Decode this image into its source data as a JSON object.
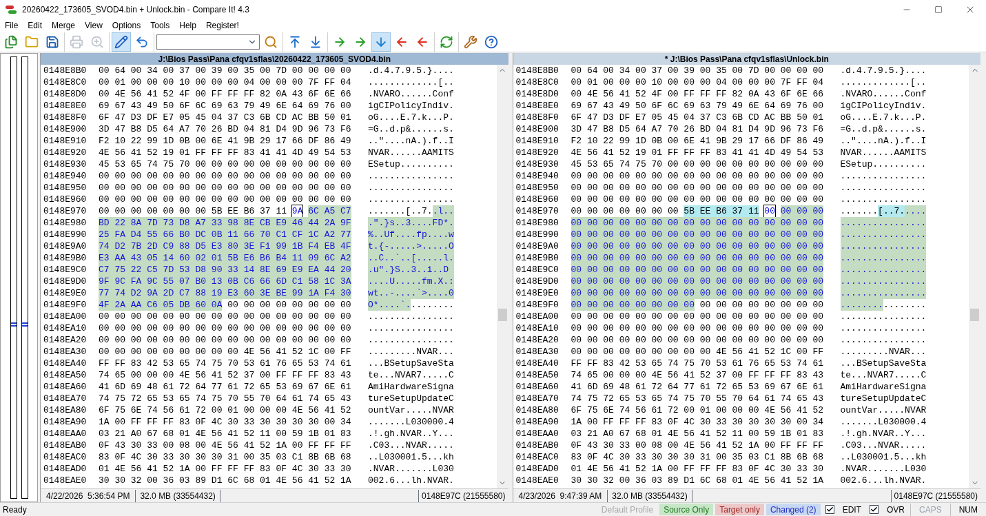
{
  "window": {
    "title": "20260422_173605_SVOD4.bin + Unlock.bin - Compare It! 4.3"
  },
  "menu": [
    "File",
    "Edit",
    "Merge",
    "View",
    "Options",
    "Tools",
    "Help",
    "Register!"
  ],
  "toolbar": [
    [
      {
        "kind": "button",
        "pressed": false,
        "disabled": false
      },
      {
        "kind": "button",
        "pressed": false,
        "disabled": false
      },
      {
        "kind": "button",
        "pressed": false,
        "disabled": false
      }
    ],
    [
      {
        "kind": "button",
        "pressed": false,
        "disabled": true
      },
      {
        "kind": "button",
        "pressed": false,
        "disabled": true
      }
    ],
    [
      {
        "kind": "button",
        "pressed": true,
        "disabled": false
      },
      {
        "kind": "button",
        "pressed": false,
        "disabled": false
      }
    ],
    [
      {
        "kind": "combo"
      },
      {
        "kind": "button",
        "pressed": false,
        "disabled": false
      }
    ],
    [
      {
        "kind": "button",
        "pressed": false,
        "disabled": false
      },
      {
        "kind": "button",
        "pressed": false,
        "disabled": false
      }
    ],
    [
      {
        "kind": "button",
        "pressed": false,
        "disabled": false
      },
      {
        "kind": "button",
        "pressed": false,
        "disabled": false
      },
      {
        "kind": "button",
        "pressed": true,
        "disabled": false
      },
      {
        "kind": "button",
        "pressed": false,
        "disabled": false
      },
      {
        "kind": "button",
        "pressed": false,
        "disabled": false
      }
    ],
    [
      {
        "kind": "button",
        "pressed": false,
        "disabled": false
      }
    ],
    [
      {
        "kind": "button",
        "pressed": false,
        "disabled": false
      },
      {
        "kind": "button",
        "pressed": false,
        "disabled": false
      }
    ]
  ],
  "panes": [
    {
      "title": "J:\\Bios Pass\\Pana cfqv1sflas\\20260422_173605_SVOD4.bin",
      "active": true,
      "rows": [
        {
          "offset": "0148E8B0",
          "hex": [
            {
              "kind": "same",
              "text": "00 64 00 34 00 37 00 39 00 35 00 7D 00 00 00 00"
            }
          ],
          "ascii": [
            {
              "kind": "same",
              "text": ".d.4.7.9.5.}...."
            }
          ]
        },
        {
          "offset": "0148E8C0",
          "hex": [
            {
              "kind": "same",
              "text": "00 01 00 00 00 10 00 00 00 04 00 00 00 7F FF 04"
            }
          ],
          "ascii": [
            {
              "kind": "same",
              "text": ".............[.."
            }
          ]
        },
        {
          "offset": "0148E8D0",
          "hex": [
            {
              "kind": "same",
              "text": "00 4E 56 41 52 4F 00 FF FF FF 82 0A 43 6F 6E 66"
            }
          ],
          "ascii": [
            {
              "kind": "same",
              "text": ".NVARO......Conf"
            }
          ]
        },
        {
          "offset": "0148E8E0",
          "hex": [
            {
              "kind": "same",
              "text": "69 67 43 49 50 6F 6C 69 63 79 49 6E 64 69 76 00"
            }
          ],
          "ascii": [
            {
              "kind": "same",
              "text": "igCIPolicyIndiv."
            }
          ]
        },
        {
          "offset": "0148E8F0",
          "hex": [
            {
              "kind": "same",
              "text": "6F 47 D3 DF E7 05 45 04 37 C3 6B CD AC BB 50 01"
            }
          ],
          "ascii": [
            {
              "kind": "same",
              "text": "oG....E.7.k...P."
            }
          ]
        },
        {
          "offset": "0148E900",
          "hex": [
            {
              "kind": "same",
              "text": "3D 47 B8 D5 64 A7 70 26 BD 04 81 D4 9D 96 73 F6"
            }
          ],
          "ascii": [
            {
              "kind": "same",
              "text": "=G..d.p&......s."
            }
          ]
        },
        {
          "offset": "0148E910",
          "hex": [
            {
              "kind": "same",
              "text": "F2 10 22 99 1D 0B 00 6E 41 9B 29 17 66 DF 86 49"
            }
          ],
          "ascii": [
            {
              "kind": "same",
              "text": "..\"....nA.).f..I"
            }
          ]
        },
        {
          "offset": "0148E920",
          "hex": [
            {
              "kind": "same",
              "text": "4E 56 41 52 19 01 FF FF FF 83 41 41 4D 49 54 53"
            }
          ],
          "ascii": [
            {
              "kind": "same",
              "text": "NVAR......AAMITS"
            }
          ]
        },
        {
          "offset": "0148E930",
          "hex": [
            {
              "kind": "same",
              "text": "45 53 65 74 75 70 00 00 00 00 00 00 00 00 00 00"
            }
          ],
          "ascii": [
            {
              "kind": "same",
              "text": "ESetup.........."
            }
          ]
        },
        {
          "offset": "0148E940",
          "hex": [
            {
              "kind": "same",
              "text": "00 00 00 00 00 00 00 00 00 00 00 00 00 00 00 00"
            }
          ],
          "ascii": [
            {
              "kind": "same",
              "text": "................"
            }
          ]
        },
        {
          "offset": "0148E950",
          "hex": [
            {
              "kind": "same",
              "text": "00 00 00 00 00 00 00 00 00 00 00 00 00 00 00 00"
            }
          ],
          "ascii": [
            {
              "kind": "same",
              "text": "................"
            }
          ]
        },
        {
          "offset": "0148E960",
          "hex": [
            {
              "kind": "same",
              "text": "00 00 00 00 00 00 00 00 00 00 00 00 00 00 00 00"
            }
          ],
          "ascii": [
            {
              "kind": "same",
              "text": "................"
            }
          ]
        },
        {
          "offset": "0148E970",
          "hex": [
            {
              "kind": "same",
              "text": "00 00 00 00 00 00 00 5B EE B6 37 11"
            },
            {
              "kind": "cursor",
              "text": "9A"
            },
            {
              "kind": "changed",
              "text": "6C A5 C7"
            }
          ],
          "ascii": [
            {
              "kind": "same",
              "text": ".......[..7."
            },
            {
              "kind": "changed",
              "text": ".l.."
            }
          ]
        },
        {
          "offset": "0148E980",
          "hex": [
            {
              "kind": "changed",
              "text": "BD 22 8A 7D 73 D8 A7 33 98 8E CB E9 46 44 2A 9F"
            }
          ],
          "ascii": [
            {
              "kind": "changed",
              "text": ".\".}s..3....FD*."
            }
          ]
        },
        {
          "offset": "0148E990",
          "hex": [
            {
              "kind": "changed",
              "text": "25 FA D4 55 66 B0 DC 0B 11 66 70 C1 CF 1C A2 77"
            }
          ],
          "ascii": [
            {
              "kind": "changed",
              "text": "%..Uf....fp....w"
            }
          ]
        },
        {
          "offset": "0148E9A0",
          "hex": [
            {
              "kind": "changed",
              "text": "74 D2 7B 2D C9 88 D5 E3 80 3E F1 99 1B F4 EB 4F"
            }
          ],
          "ascii": [
            {
              "kind": "changed",
              "text": "t.{-.....>.....O"
            }
          ]
        },
        {
          "offset": "0148E9B0",
          "hex": [
            {
              "kind": "changed",
              "text": "E3 AA 43 05 14 60 02 01 5B E6 B6 B4 11 09 6C A2"
            }
          ],
          "ascii": [
            {
              "kind": "changed",
              "text": "..C..`..[.....l."
            }
          ]
        },
        {
          "offset": "0148E9C0",
          "hex": [
            {
              "kind": "changed",
              "text": "C7 75 22 C5 7D 53 D8 90 33 14 8E 69 E9 EA 44 20"
            }
          ],
          "ascii": [
            {
              "kind": "changed",
              "text": ".u\".}S..3..i..D "
            }
          ]
        },
        {
          "offset": "0148E9D0",
          "hex": [
            {
              "kind": "changed",
              "text": "9F 9C FA 9C 55 07 B0 13 0B C6 66 6D C1 58 1C 3A"
            }
          ],
          "ascii": [
            {
              "kind": "changed",
              "text": "....U.....fm.X.:"
            }
          ]
        },
        {
          "offset": "0148E9E0",
          "hex": [
            {
              "kind": "changed",
              "text": "77 74 D2 9A 2D C7 88 19 E3 60 3E BE 99 1A F4 30"
            }
          ],
          "ascii": [
            {
              "kind": "changed",
              "text": "wt..-....`>....0"
            }
          ]
        },
        {
          "offset": "0148E9F0",
          "hex": [
            {
              "kind": "changed",
              "text": "4F 2A AA C6 05 DB 60 0A"
            },
            {
              "kind": "same",
              "text": "00 00 00 00 00 00 00 00"
            }
          ],
          "ascii": [
            {
              "kind": "changed",
              "text": "O*....`."
            },
            {
              "kind": "same",
              "text": "........"
            }
          ]
        },
        {
          "offset": "0148EA00",
          "hex": [
            {
              "kind": "same",
              "text": "00 00 00 00 00 00 00 00 00 00 00 00 00 00 00 00"
            }
          ],
          "ascii": [
            {
              "kind": "same",
              "text": "................"
            }
          ]
        },
        {
          "offset": "0148EA10",
          "hex": [
            {
              "kind": "same",
              "text": "00 00 00 00 00 00 00 00 00 00 00 00 00 00 00 00"
            }
          ],
          "ascii": [
            {
              "kind": "same",
              "text": "................"
            }
          ]
        },
        {
          "offset": "0148EA20",
          "hex": [
            {
              "kind": "same",
              "text": "00 00 00 00 00 00 00 00 00 00 00 00 00 00 00 00"
            }
          ],
          "ascii": [
            {
              "kind": "same",
              "text": "................"
            }
          ]
        },
        {
          "offset": "0148EA30",
          "hex": [
            {
              "kind": "same",
              "text": "00 00 00 00 00 00 00 00 00 4E 56 41 52 1C 00 FF"
            }
          ],
          "ascii": [
            {
              "kind": "same",
              "text": ".........NVAR..."
            }
          ]
        },
        {
          "offset": "0148EA40",
          "hex": [
            {
              "kind": "same",
              "text": "FF FF 83 42 53 65 74 75 70 53 61 76 65 53 74 61"
            }
          ],
          "ascii": [
            {
              "kind": "same",
              "text": "...BSetupSaveSta"
            }
          ]
        },
        {
          "offset": "0148EA50",
          "hex": [
            {
              "kind": "same",
              "text": "74 65 00 00 00 4E 56 41 52 37 00 FF FF FF 83 43"
            }
          ],
          "ascii": [
            {
              "kind": "same",
              "text": "te...NVAR7.....C"
            }
          ]
        },
        {
          "offset": "0148EA60",
          "hex": [
            {
              "kind": "same",
              "text": "41 6D 69 48 61 72 64 77 61 72 65 53 69 67 6E 61"
            }
          ],
          "ascii": [
            {
              "kind": "same",
              "text": "AmiHardwareSigna"
            }
          ]
        },
        {
          "offset": "0148EA70",
          "hex": [
            {
              "kind": "same",
              "text": "74 75 72 65 53 65 74 75 70 55 70 64 61 74 65 43"
            }
          ],
          "ascii": [
            {
              "kind": "same",
              "text": "tureSetupUpdateC"
            }
          ]
        },
        {
          "offset": "0148EA80",
          "hex": [
            {
              "kind": "same",
              "text": "6F 75 6E 74 56 61 72 00 01 00 00 00 4E 56 41 52"
            }
          ],
          "ascii": [
            {
              "kind": "same",
              "text": "ountVar.....NVAR"
            }
          ]
        },
        {
          "offset": "0148EA90",
          "hex": [
            {
              "kind": "same",
              "text": "1A 00 FF FF FF 83 0F 4C 30 33 30 30 30 30 00 34"
            }
          ],
          "ascii": [
            {
              "kind": "same",
              "text": ".......L030000.4"
            }
          ]
        },
        {
          "offset": "0148EAA0",
          "hex": [
            {
              "kind": "same",
              "text": "03 21 A0 67 68 01 4E 56 41 52 11 00 59 1B 01 83"
            }
          ],
          "ascii": [
            {
              "kind": "same",
              "text": ".!.gh.NVAR..Y..."
            }
          ]
        },
        {
          "offset": "0148EAB0",
          "hex": [
            {
              "kind": "same",
              "text": "0F 43 30 33 00 08 00 4E 56 41 52 1A 00 FF FF FF"
            }
          ],
          "ascii": [
            {
              "kind": "same",
              "text": ".C03...NVAR....."
            }
          ]
        },
        {
          "offset": "0148EAC0",
          "hex": [
            {
              "kind": "same",
              "text": "83 0F 4C 30 33 30 30 30 31 00 35 03 C1 8B 6B 68"
            }
          ],
          "ascii": [
            {
              "kind": "same",
              "text": "..L030001.5...kh"
            }
          ]
        },
        {
          "offset": "0148EAD0",
          "hex": [
            {
              "kind": "same",
              "text": "01 4E 56 41 52 1A 00 FF FF FF 83 0F 4C 30 33 30"
            }
          ],
          "ascii": [
            {
              "kind": "same",
              "text": ".NVAR.......L030"
            }
          ]
        },
        {
          "offset": "0148EAE0",
          "hex": [
            {
              "kind": "same",
              "text": "30 30 32 00 36 03 89 D1 6C 68 01 4E 56 41 52 1A"
            }
          ],
          "ascii": [
            {
              "kind": "same",
              "text": "002.6...lh.NVAR."
            }
          ]
        }
      ],
      "status": {
        "date": "4/22/2026  5:36:54 PM",
        "size": "32.0 MB (33554432)",
        "position": "0148E97C (21555580)"
      }
    },
    {
      "title": "* J:\\Bios Pass\\Pana cfqv1sflas\\Unlock.bin",
      "active": false,
      "rows": [
        {
          "offset": "0148E8B0",
          "hex": [
            {
              "kind": "same",
              "text": "00 64 00 34 00 37 00 39 00 35 00 7D 00 00 00 00"
            }
          ],
          "ascii": [
            {
              "kind": "same",
              "text": ".d.4.7.9.5.}...."
            }
          ]
        },
        {
          "offset": "0148E8C0",
          "hex": [
            {
              "kind": "same",
              "text": "00 01 00 00 00 10 00 00 00 04 00 00 00 7F FF 04"
            }
          ],
          "ascii": [
            {
              "kind": "same",
              "text": ".............[.."
            }
          ]
        },
        {
          "offset": "0148E8D0",
          "hex": [
            {
              "kind": "same",
              "text": "00 4E 56 41 52 4F 00 FF FF FF 82 0A 43 6F 6E 66"
            }
          ],
          "ascii": [
            {
              "kind": "same",
              "text": ".NVARO......Conf"
            }
          ]
        },
        {
          "offset": "0148E8E0",
          "hex": [
            {
              "kind": "same",
              "text": "69 67 43 49 50 6F 6C 69 63 79 49 6E 64 69 76 00"
            }
          ],
          "ascii": [
            {
              "kind": "same",
              "text": "igCIPolicyIndiv."
            }
          ]
        },
        {
          "offset": "0148E8F0",
          "hex": [
            {
              "kind": "same",
              "text": "6F 47 D3 DF E7 05 45 04 37 C3 6B CD AC BB 50 01"
            }
          ],
          "ascii": [
            {
              "kind": "same",
              "text": "oG....E.7.k...P."
            }
          ]
        },
        {
          "offset": "0148E900",
          "hex": [
            {
              "kind": "same",
              "text": "3D 47 B8 D5 64 A7 70 26 BD 04 81 D4 9D 96 73 F6"
            }
          ],
          "ascii": [
            {
              "kind": "same",
              "text": "=G..d.p&......s."
            }
          ]
        },
        {
          "offset": "0148E910",
          "hex": [
            {
              "kind": "same",
              "text": "F2 10 22 99 1D 0B 00 6E 41 9B 29 17 66 DF 86 49"
            }
          ],
          "ascii": [
            {
              "kind": "same",
              "text": "..\"....nA.).f..I"
            }
          ]
        },
        {
          "offset": "0148E920",
          "hex": [
            {
              "kind": "same",
              "text": "4E 56 41 52 19 01 FF FF FF 83 41 41 4D 49 54 53"
            }
          ],
          "ascii": [
            {
              "kind": "same",
              "text": "NVAR......AAMITS"
            }
          ]
        },
        {
          "offset": "0148E930",
          "hex": [
            {
              "kind": "same",
              "text": "45 53 65 74 75 70 00 00 00 00 00 00 00 00 00 00"
            }
          ],
          "ascii": [
            {
              "kind": "same",
              "text": "ESetup.........."
            }
          ]
        },
        {
          "offset": "0148E940",
          "hex": [
            {
              "kind": "same",
              "text": "00 00 00 00 00 00 00 00 00 00 00 00 00 00 00 00"
            }
          ],
          "ascii": [
            {
              "kind": "same",
              "text": "................"
            }
          ]
        },
        {
          "offset": "0148E950",
          "hex": [
            {
              "kind": "same",
              "text": "00 00 00 00 00 00 00 00 00 00 00 00 00 00 00 00"
            }
          ],
          "ascii": [
            {
              "kind": "same",
              "text": "................"
            }
          ]
        },
        {
          "offset": "0148E960",
          "hex": [
            {
              "kind": "same",
              "text": "00 00 00 00 00 00 00 00 00 00 00 00 00 00 00 00"
            }
          ],
          "ascii": [
            {
              "kind": "same",
              "text": "................"
            }
          ]
        },
        {
          "offset": "0148E970",
          "hex": [
            {
              "kind": "same",
              "text": "00 00 00 00 00 00 00"
            },
            {
              "kind": "matched",
              "text": "5B EE B6 37 11"
            },
            {
              "kind": "cursor",
              "text": "00"
            },
            {
              "kind": "changed",
              "text": "00 00 00"
            }
          ],
          "ascii": [
            {
              "kind": "same",
              "text": "......."
            },
            {
              "kind": "matched",
              "text": "[..7."
            },
            {
              "kind": "changed",
              "text": "...."
            }
          ]
        },
        {
          "offset": "0148E980",
          "hex": [
            {
              "kind": "changed",
              "text": "00 00 00 00 00 00 00 00 00 00 00 00 00 00 00 00"
            }
          ],
          "ascii": [
            {
              "kind": "changed",
              "text": "................"
            }
          ]
        },
        {
          "offset": "0148E990",
          "hex": [
            {
              "kind": "changed",
              "text": "00 00 00 00 00 00 00 00 00 00 00 00 00 00 00 00"
            }
          ],
          "ascii": [
            {
              "kind": "changed",
              "text": "................"
            }
          ]
        },
        {
          "offset": "0148E9A0",
          "hex": [
            {
              "kind": "changed",
              "text": "00 00 00 00 00 00 00 00 00 00 00 00 00 00 00 00"
            }
          ],
          "ascii": [
            {
              "kind": "changed",
              "text": "................"
            }
          ]
        },
        {
          "offset": "0148E9B0",
          "hex": [
            {
              "kind": "changed",
              "text": "00 00 00 00 00 00 00 00 00 00 00 00 00 00 00 00"
            }
          ],
          "ascii": [
            {
              "kind": "changed",
              "text": "................"
            }
          ]
        },
        {
          "offset": "0148E9C0",
          "hex": [
            {
              "kind": "changed",
              "text": "00 00 00 00 00 00 00 00 00 00 00 00 00 00 00 00"
            }
          ],
          "ascii": [
            {
              "kind": "changed",
              "text": "................"
            }
          ]
        },
        {
          "offset": "0148E9D0",
          "hex": [
            {
              "kind": "changed",
              "text": "00 00 00 00 00 00 00 00 00 00 00 00 00 00 00 00"
            }
          ],
          "ascii": [
            {
              "kind": "changed",
              "text": "................"
            }
          ]
        },
        {
          "offset": "0148E9E0",
          "hex": [
            {
              "kind": "changed",
              "text": "00 00 00 00 00 00 00 00 00 00 00 00 00 00 00 00"
            }
          ],
          "ascii": [
            {
              "kind": "changed",
              "text": "................"
            }
          ]
        },
        {
          "offset": "0148E9F0",
          "hex": [
            {
              "kind": "changed",
              "text": "00 00 00 00 00 00 00 00"
            },
            {
              "kind": "same",
              "text": "00 00 00 00 00 00 00 00"
            }
          ],
          "ascii": [
            {
              "kind": "changed",
              "text": "........"
            },
            {
              "kind": "same",
              "text": "........"
            }
          ]
        },
        {
          "offset": "0148EA00",
          "hex": [
            {
              "kind": "same",
              "text": "00 00 00 00 00 00 00 00 00 00 00 00 00 00 00 00"
            }
          ],
          "ascii": [
            {
              "kind": "same",
              "text": "................"
            }
          ]
        },
        {
          "offset": "0148EA10",
          "hex": [
            {
              "kind": "same",
              "text": "00 00 00 00 00 00 00 00 00 00 00 00 00 00 00 00"
            }
          ],
          "ascii": [
            {
              "kind": "same",
              "text": "................"
            }
          ]
        },
        {
          "offset": "0148EA20",
          "hex": [
            {
              "kind": "same",
              "text": "00 00 00 00 00 00 00 00 00 00 00 00 00 00 00 00"
            }
          ],
          "ascii": [
            {
              "kind": "same",
              "text": "................"
            }
          ]
        },
        {
          "offset": "0148EA30",
          "hex": [
            {
              "kind": "same",
              "text": "00 00 00 00 00 00 00 00 00 4E 56 41 52 1C 00 FF"
            }
          ],
          "ascii": [
            {
              "kind": "same",
              "text": ".........NVAR..."
            }
          ]
        },
        {
          "offset": "0148EA40",
          "hex": [
            {
              "kind": "same",
              "text": "FF FF 83 42 53 65 74 75 70 53 61 76 65 53 74 61"
            }
          ],
          "ascii": [
            {
              "kind": "same",
              "text": "...BSetupSaveSta"
            }
          ]
        },
        {
          "offset": "0148EA50",
          "hex": [
            {
              "kind": "same",
              "text": "74 65 00 00 00 4E 56 41 52 37 00 FF FF FF 83 43"
            }
          ],
          "ascii": [
            {
              "kind": "same",
              "text": "te...NVAR7.....C"
            }
          ]
        },
        {
          "offset": "0148EA60",
          "hex": [
            {
              "kind": "same",
              "text": "41 6D 69 48 61 72 64 77 61 72 65 53 69 67 6E 61"
            }
          ],
          "ascii": [
            {
              "kind": "same",
              "text": "AmiHardwareSigna"
            }
          ]
        },
        {
          "offset": "0148EA70",
          "hex": [
            {
              "kind": "same",
              "text": "74 75 72 65 53 65 74 75 70 55 70 64 61 74 65 43"
            }
          ],
          "ascii": [
            {
              "kind": "same",
              "text": "tureSetupUpdateC"
            }
          ]
        },
        {
          "offset": "0148EA80",
          "hex": [
            {
              "kind": "same",
              "text": "6F 75 6E 74 56 61 72 00 01 00 00 00 4E 56 41 52"
            }
          ],
          "ascii": [
            {
              "kind": "same",
              "text": "ountVar.....NVAR"
            }
          ]
        },
        {
          "offset": "0148EA90",
          "hex": [
            {
              "kind": "same",
              "text": "1A 00 FF FF FF 83 0F 4C 30 33 30 30 30 30 00 34"
            }
          ],
          "ascii": [
            {
              "kind": "same",
              "text": ".......L030000.4"
            }
          ]
        },
        {
          "offset": "0148EAA0",
          "hex": [
            {
              "kind": "same",
              "text": "03 21 A0 67 68 01 4E 56 41 52 11 00 59 1B 01 83"
            }
          ],
          "ascii": [
            {
              "kind": "same",
              "text": ".!.gh.NVAR..Y..."
            }
          ]
        },
        {
          "offset": "0148EAB0",
          "hex": [
            {
              "kind": "same",
              "text": "0F 43 30 33 00 08 00 4E 56 41 52 1A 00 FF FF FF"
            }
          ],
          "ascii": [
            {
              "kind": "same",
              "text": ".C03...NVAR....."
            }
          ]
        },
        {
          "offset": "0148EAC0",
          "hex": [
            {
              "kind": "same",
              "text": "83 0F 4C 30 33 30 30 30 31 00 35 03 C1 8B 6B 68"
            }
          ],
          "ascii": [
            {
              "kind": "same",
              "text": "..L030001.5...kh"
            }
          ]
        },
        {
          "offset": "0148EAD0",
          "hex": [
            {
              "kind": "same",
              "text": "01 4E 56 41 52 1A 00 FF FF FF 83 0F 4C 30 33 30"
            }
          ],
          "ascii": [
            {
              "kind": "same",
              "text": ".NVAR.......L030"
            }
          ]
        },
        {
          "offset": "0148EAE0",
          "hex": [
            {
              "kind": "same",
              "text": "30 30 32 00 36 03 89 D1 6C 68 01 4E 56 41 52 1A"
            }
          ],
          "ascii": [
            {
              "kind": "same",
              "text": "002.6...lh.NVAR."
            }
          ]
        }
      ],
      "status": {
        "date": "4/23/2026  9:47:39 AM",
        "size": "32.0 MB (33554432)",
        "position": "0148E97C (21555580)"
      }
    }
  ],
  "status_bar": {
    "message": "Ready",
    "legend": [
      {
        "kind": "profile",
        "label": "Default Profile",
        "disabled": true
      },
      {
        "kind": "source",
        "label": "Source Only",
        "disabled": false
      },
      {
        "kind": "target",
        "label": "Target only",
        "disabled": false
      },
      {
        "kind": "changed",
        "label": "Changed (2)",
        "disabled": false
      }
    ],
    "toggles": [
      {
        "label": "EDIT",
        "checked": true
      },
      {
        "label": "OVR",
        "checked": true
      }
    ],
    "keys": [
      {
        "label": "CAPS",
        "disabled": true
      },
      {
        "label": "NUM",
        "disabled": false
      }
    ]
  }
}
